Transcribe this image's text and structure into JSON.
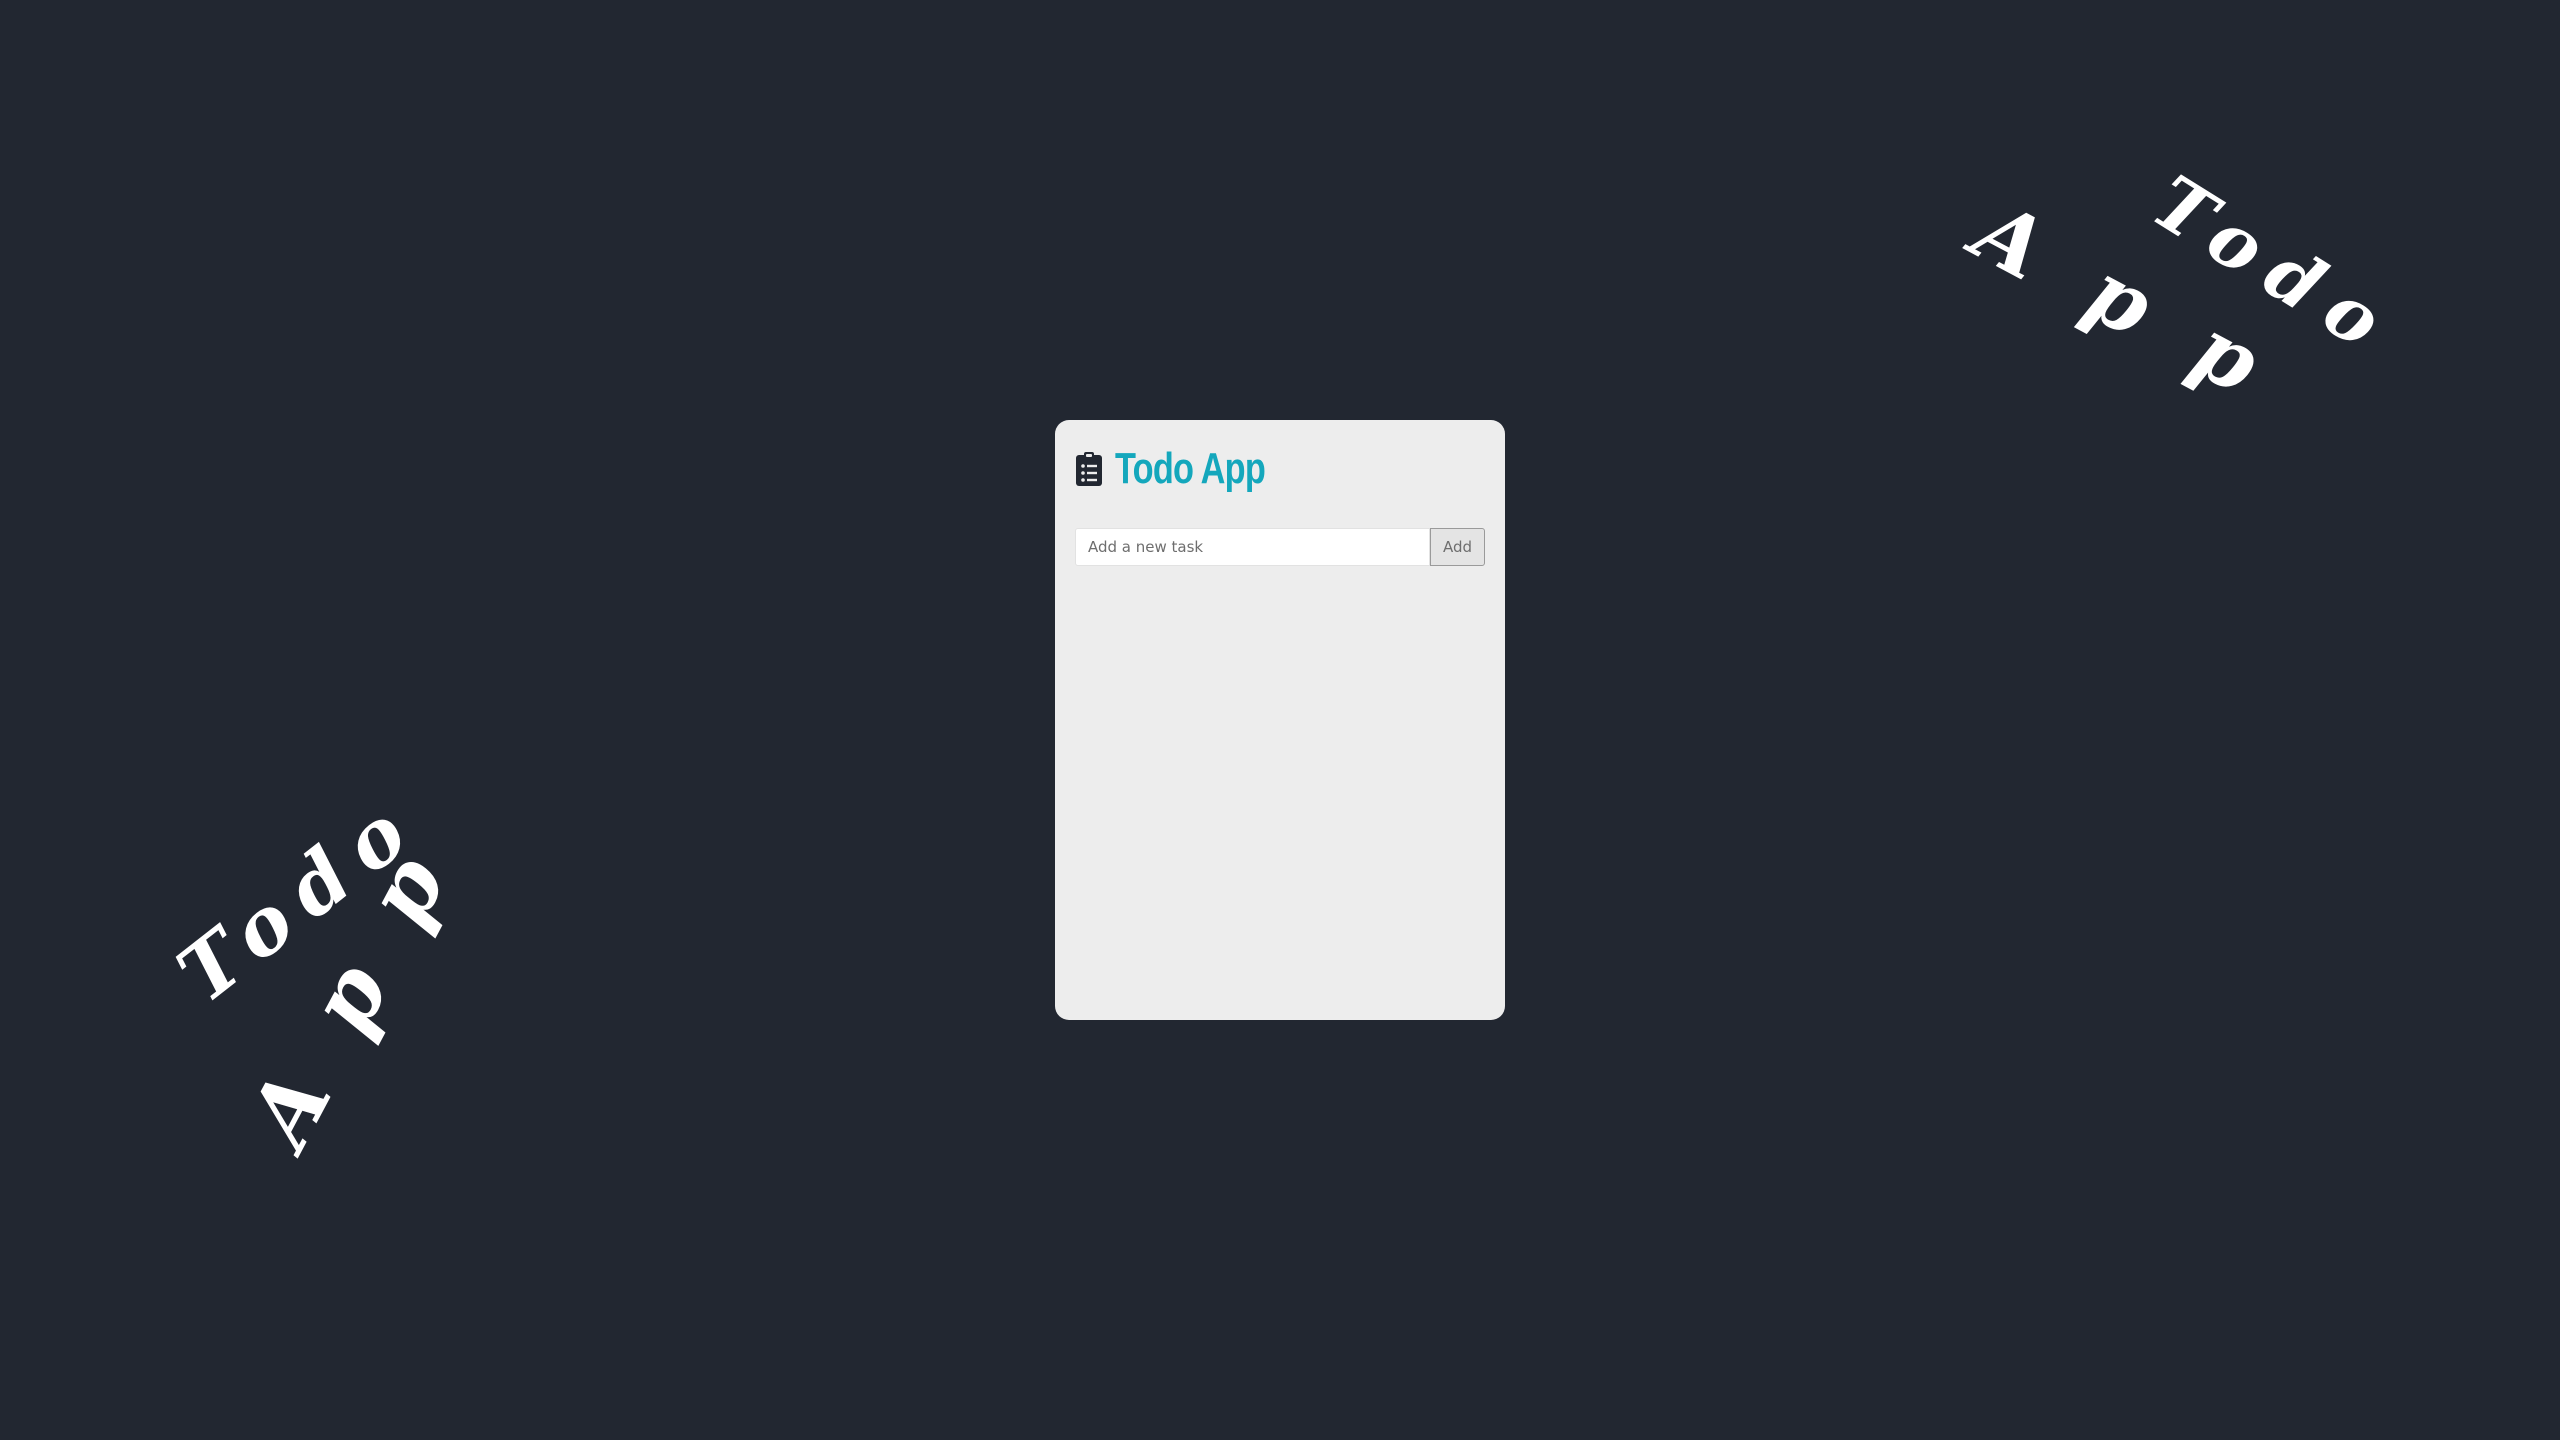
{
  "app": {
    "title": "Todo App",
    "icon": "clipboard-list-icon",
    "accent_color": "#14a7bc"
  },
  "form": {
    "placeholder": "Add a new task",
    "value": "",
    "add_label": "Add"
  },
  "decorations": {
    "left_word_top": "Todo",
    "left_word_bottom": "App",
    "right_word_top": "Todo",
    "right_word_bottom": "App"
  },
  "tasks": []
}
